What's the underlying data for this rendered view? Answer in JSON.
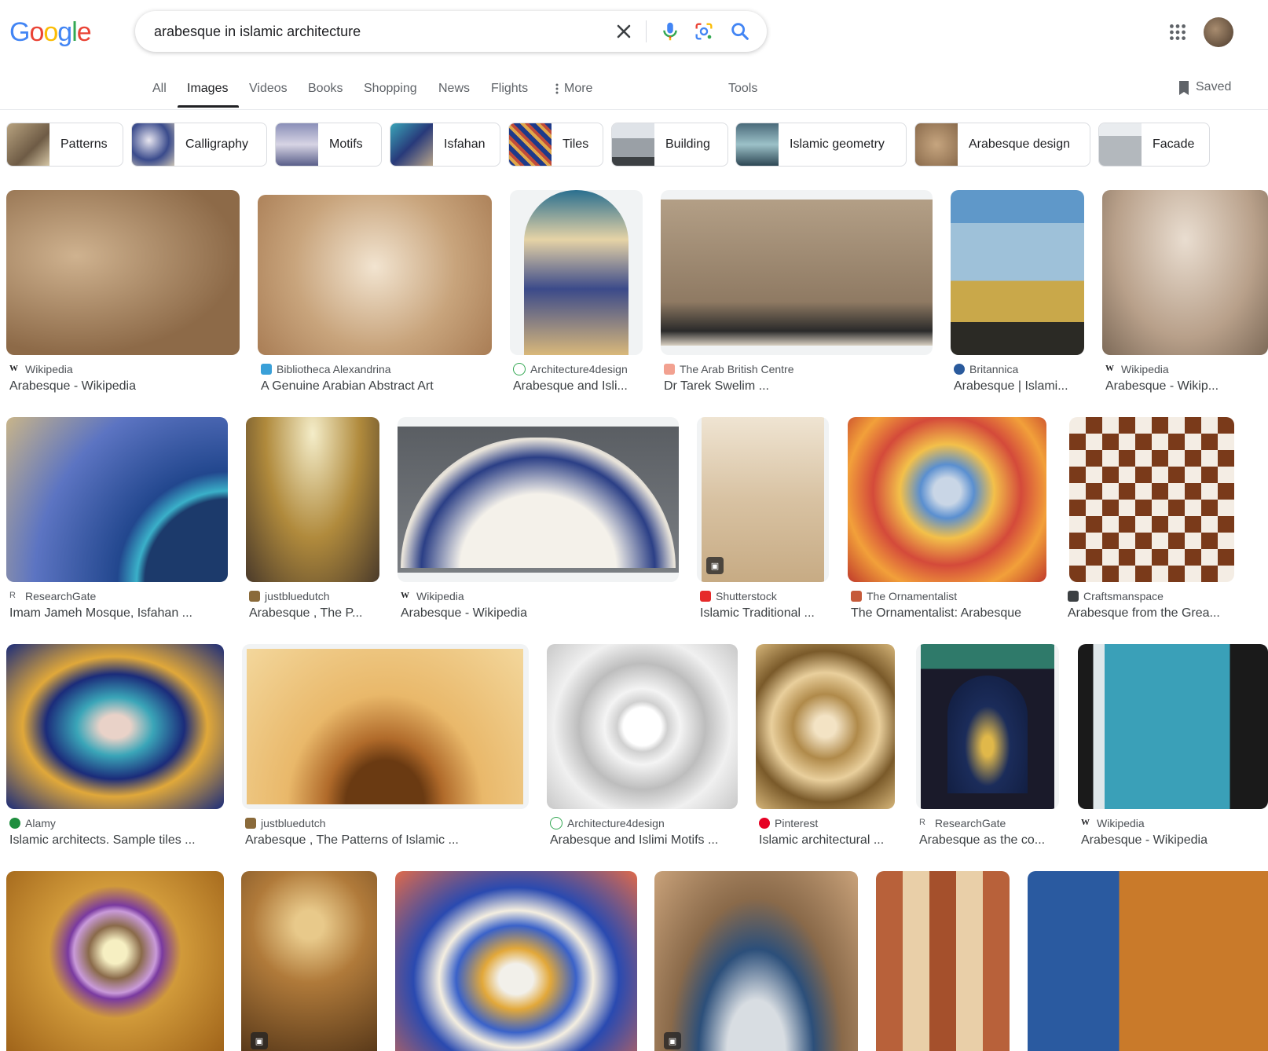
{
  "header": {
    "logo_letters": [
      {
        "ch": "G",
        "color": "#4285F4"
      },
      {
        "ch": "o",
        "color": "#EA4335"
      },
      {
        "ch": "o",
        "color": "#FBBC05"
      },
      {
        "ch": "g",
        "color": "#4285F4"
      },
      {
        "ch": "l",
        "color": "#34A853"
      },
      {
        "ch": "e",
        "color": "#EA4335"
      }
    ],
    "query": "arabesque in islamic architecture"
  },
  "nav": {
    "all": "All",
    "images": "Images",
    "videos": "Videos",
    "books": "Books",
    "shopping": "Shopping",
    "news": "News",
    "flights": "Flights",
    "more": "More",
    "tools": "Tools",
    "saved": "Saved"
  },
  "chips": [
    {
      "label": "Patterns"
    },
    {
      "label": "Calligraphy"
    },
    {
      "label": "Motifs"
    },
    {
      "label": "Isfahan"
    },
    {
      "label": "Tiles"
    },
    {
      "label": "Building"
    },
    {
      "label": "Islamic geometry"
    },
    {
      "label": "Arabesque design"
    },
    {
      "label": "Facade"
    }
  ],
  "results": [
    {
      "source": "Wikipedia",
      "title": "Arabesque - Wikipedia"
    },
    {
      "source": "Bibliotheca Alexandrina",
      "title": "A Genuine Arabian Abstract Art"
    },
    {
      "source": "Architecture4design",
      "title": "Arabesque and Isli..."
    },
    {
      "source": "The Arab British Centre",
      "title": "Dr Tarek Swelim ..."
    },
    {
      "source": "Britannica",
      "title": "Arabesque | Islami..."
    },
    {
      "source": "Wikipedia",
      "title": "Arabesque - Wikip..."
    },
    {
      "source": "ResearchGate",
      "title": "Imam Jameh Mosque, Isfahan ..."
    },
    {
      "source": "justbluedutch",
      "title": "Arabesque , The P..."
    },
    {
      "source": "Wikipedia",
      "title": "Arabesque - Wikipedia"
    },
    {
      "source": "Shutterstock",
      "title": "Islamic Traditional ..."
    },
    {
      "source": "The Ornamentalist",
      "title": "The Ornamentalist: Arabesque"
    },
    {
      "source": "Craftsmanspace",
      "title": "Arabesque from the Grea..."
    },
    {
      "source": "Alamy",
      "title": "Islamic architects. Sample tiles ..."
    },
    {
      "source": "justbluedutch",
      "title": "Arabesque , The Patterns of Islamic ..."
    },
    {
      "source": "Architecture4design",
      "title": "Arabesque and Islimi Motifs ..."
    },
    {
      "source": "Pinterest",
      "title": "Islamic architectural ..."
    },
    {
      "source": "ResearchGate",
      "title": "Arabesque as the co..."
    },
    {
      "source": "Wikipedia",
      "title": "Arabesque - Wikipedia"
    }
  ],
  "colors": {
    "accent_blue": "#1a73e8",
    "text_secondary": "#5f6368"
  }
}
